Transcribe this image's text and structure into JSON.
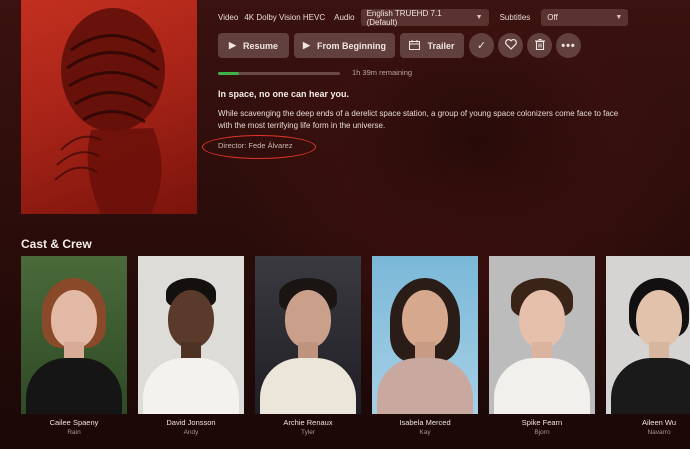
{
  "media_info": {
    "video_label": "Video",
    "video_value": "4K Dolby Vision HEVC",
    "audio_label": "Audio",
    "audio_value": "English TRUEHD 7.1 (Default)",
    "subtitles_label": "Subtitles",
    "subtitles_value": "Off"
  },
  "actions": {
    "resume_label": "Resume",
    "from_beginning_label": "From Beginning",
    "trailer_label": "Trailer"
  },
  "playback": {
    "progress_percent": 17,
    "remaining_text": "1h 39m remaining"
  },
  "details": {
    "tagline": "In space, no one can hear you.",
    "summary": "While scavenging the deep ends of a derelict space station, a group of young space colonizers come face to face with the most terrifying life form in the universe.",
    "director": "Director: Fede Álvarez"
  },
  "cast_section": {
    "heading": "Cast & Crew",
    "members": [
      {
        "name": "Cailee Spaeny",
        "role": "Rain"
      },
      {
        "name": "David Jonsson",
        "role": "Andy"
      },
      {
        "name": "Archie Renaux",
        "role": "Tyler"
      },
      {
        "name": "Isabela Merced",
        "role": "Kay"
      },
      {
        "name": "Spike Fearn",
        "role": "Bjorn"
      },
      {
        "name": "Aileen Wu",
        "role": "Navarro"
      }
    ]
  },
  "colors": {
    "accent_progress": "#3fb14b",
    "annotation_ring": "#e0342a",
    "button_bg": "#62403d"
  },
  "icons": [
    "play-icon",
    "restart-icon",
    "calendar-icon",
    "check-icon",
    "heart-icon",
    "trash-icon",
    "more-icon",
    "chevron-down-icon"
  ]
}
